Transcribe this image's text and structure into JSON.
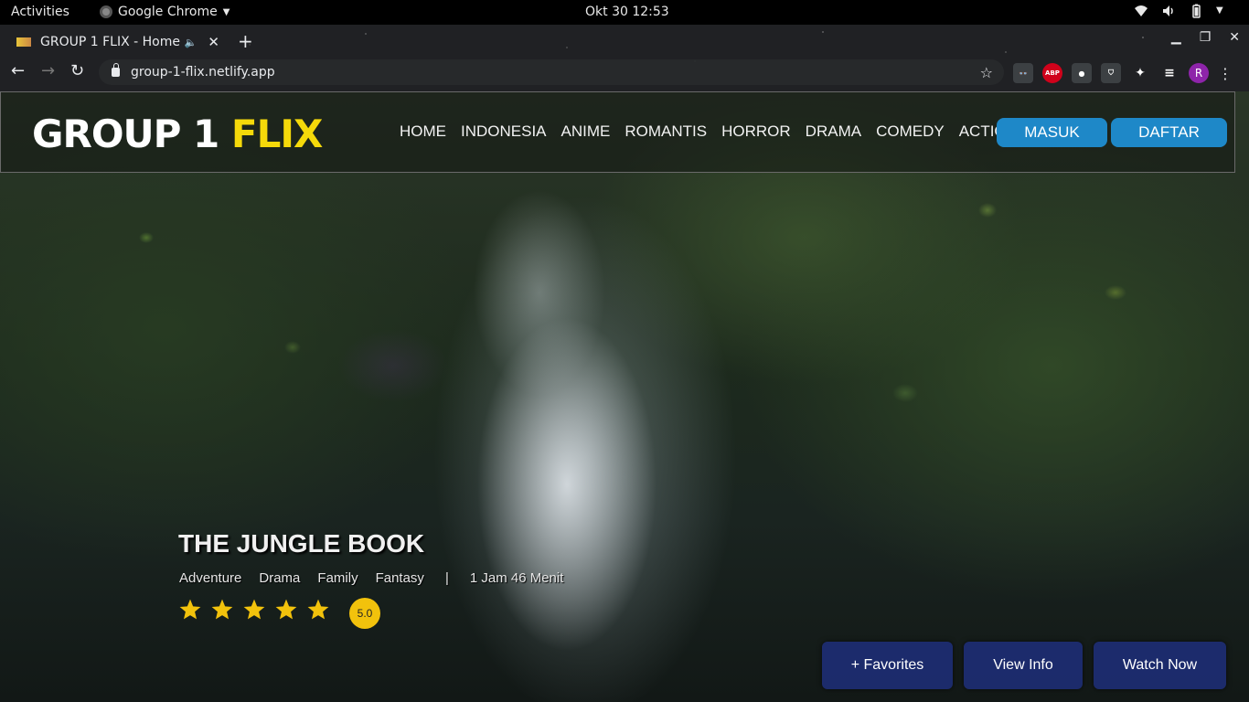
{
  "system_bar": {
    "activities": "Activities",
    "app_name": "Google Chrome",
    "clock": "Okt 30  12:53"
  },
  "browser": {
    "tab_title": "GROUP 1 FLIX - Home",
    "url": "group-1-flix.netlify.app",
    "profile_initial": "R",
    "abp_label": "ABP"
  },
  "site": {
    "logo_part1": "GROUP 1 ",
    "logo_part2": "FLIX",
    "logo_accent_color": "#f5d90a",
    "nav": [
      "HOME",
      "INDONESIA",
      "ANIME",
      "ROMANTIS",
      "HORROR",
      "DRAMA",
      "COMEDY",
      "ACTION"
    ],
    "login_label": "MASUK",
    "register_label": "DAFTAR",
    "auth_button_color": "#1e88c8"
  },
  "hero": {
    "title": "THE JUNGLE BOOK",
    "genres": [
      "Adventure",
      "Drama",
      "Family",
      "Fantasy"
    ],
    "separator": "|",
    "duration": "1 Jam 46 Menit",
    "stars": 5,
    "rating": "5.0",
    "star_color": "#f2c20c",
    "buttons": {
      "favorites": "+ Favorites",
      "view_info": "View Info",
      "watch_now": "Watch Now"
    },
    "button_color": "#1e2d78"
  }
}
